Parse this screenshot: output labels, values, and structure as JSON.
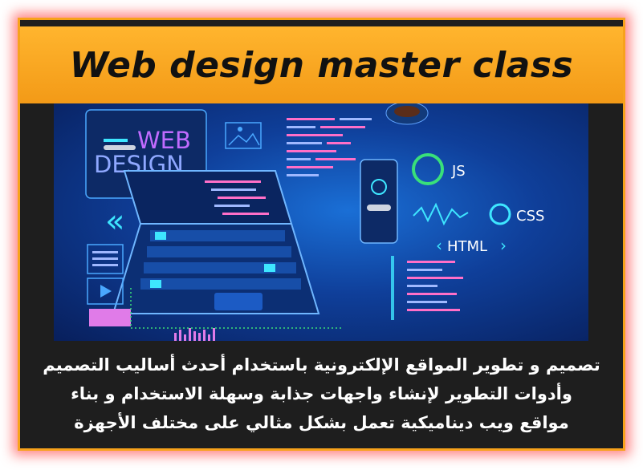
{
  "banner": {
    "title": "Web design master class"
  },
  "illustration": {
    "screen_heading_line1": "WEB",
    "screen_heading_line2": "DESIGN",
    "js_label": "JS",
    "css_label": "CSS",
    "html_label": "HTML"
  },
  "description": {
    "line1": "تصميم و تطوير المواقع الإلكترونية باستخدام أحدث أساليب التصميم",
    "line2": "وأدوات التطوير لإنشاء واجهات جذابة وسهلة الاستخدام و بناء",
    "line3": "مواقع ويب ديناميكية تعمل بشكل مثالي على مختلف الأجهزة"
  },
  "colors": {
    "banner": "#f7a21b",
    "glow": "#ff2828",
    "card": "#1e1e1e",
    "hero": "#0f3f9a",
    "accent_cyan": "#3ee6ff",
    "accent_pink": "#ff6fc8"
  }
}
